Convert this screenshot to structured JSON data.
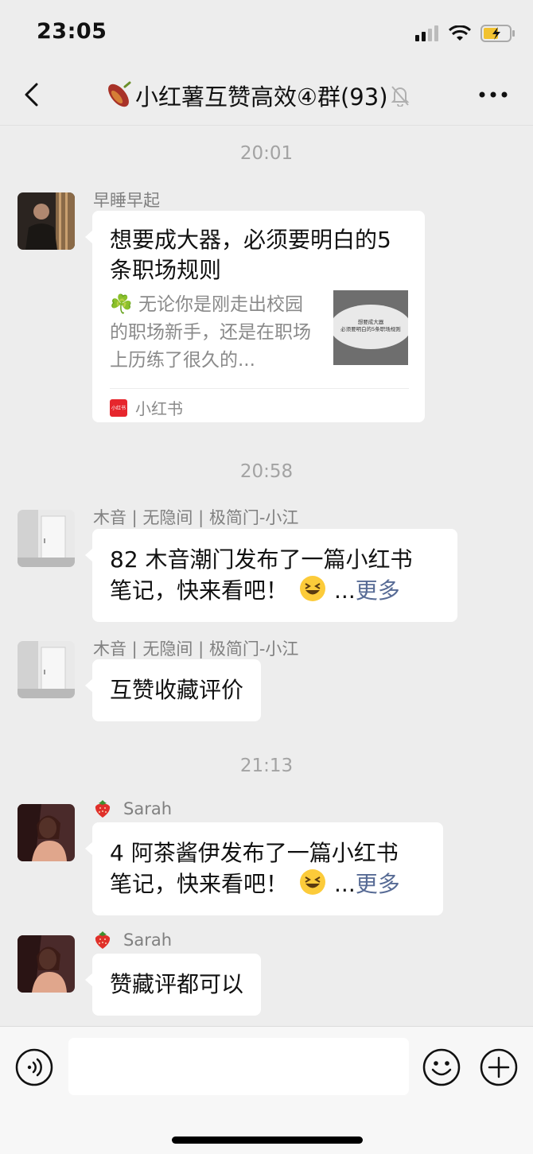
{
  "status": {
    "time": "23:05"
  },
  "nav": {
    "title": "小红薯互赞高效④群(93)"
  },
  "messages": {
    "ts1": "20:01",
    "m1": {
      "sender": "早睡早起",
      "card_title": "想要成大器，必须要明白的5条职场规则",
      "card_desc": "☘️ 无论你是刚走出校园的职场新手，还是在职场上历练了很久的...",
      "thumb_line1": "想要成大器",
      "thumb_line2": "必须要明白的5条职场规则",
      "source_logo": "小红书",
      "source": "小红书"
    },
    "ts2": "20:58",
    "m2": {
      "sender": "木音 | 无隐间 | 极简门-小江",
      "text_line1": "82 木音潮门发布了一篇小红书",
      "text_line2": "笔记，快来看吧！",
      "ellipsis": "...",
      "more": "更多"
    },
    "m3": {
      "sender": "木音 | 无隐间 | 极简门-小江",
      "text": "互赞收藏评价"
    },
    "ts3": "21:13",
    "m4": {
      "sender": "Sarah",
      "text_line1": "4 阿茶酱伊发布了一篇小红书",
      "text_line2": "笔记，快来看吧！",
      "ellipsis": "...",
      "more": "更多"
    },
    "m5": {
      "sender": "Sarah",
      "text": "赞藏评都可以"
    }
  },
  "input": {
    "placeholder": ""
  },
  "icons": {
    "signal": "signal-icon",
    "wifi": "wifi-icon",
    "battery": "battery-charging-icon",
    "back": "chevron-left-icon",
    "mute": "bell-off-icon",
    "more": "more-dots-icon",
    "voice": "voice-icon",
    "emoji": "emoji-icon",
    "plus": "plus-icon",
    "sweet_potato": "sweet-potato-emoji",
    "strawberry": "strawberry-emoji",
    "laugh": "grinning-squint-emoji"
  },
  "colors": {
    "link": "#576b95",
    "background": "#ededed",
    "bubble": "#ffffff",
    "brand_red": "#e6262d"
  }
}
